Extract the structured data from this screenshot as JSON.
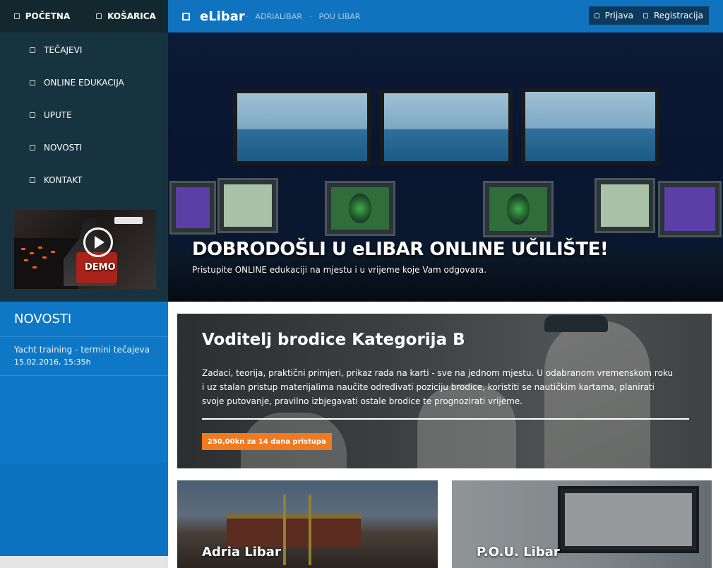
{
  "sidebar": {
    "top": [
      {
        "label": "POČETNA",
        "icon": "square-icon"
      },
      {
        "label": "KOŠARICA",
        "icon": "square-icon"
      }
    ],
    "menu": [
      {
        "label": "TEČAJEVI"
      },
      {
        "label": "ONLINE EDUKACIJA"
      },
      {
        "label": "UPUTE"
      },
      {
        "label": "NOVOSTI"
      },
      {
        "label": "KONTAKT"
      }
    ],
    "demo_label": "DEMO"
  },
  "news": {
    "heading": "NOVOSTI",
    "items": [
      {
        "title": "Yacht training - termini tečajeva",
        "date": "15.02.2016, 15:35h"
      }
    ]
  },
  "header": {
    "brand": "eLibar",
    "crumbs": [
      "ADRIALIBAR",
      "POU LIBAR"
    ],
    "login": "Prijava",
    "register": "Registracija"
  },
  "hero": {
    "title": "DOBRODOŠLI U eLIBAR ONLINE UČILIŠTE!",
    "subtitle": "Pristupite ONLINE edukaciji na mjestu i u vrijeme koje Vam odgovara."
  },
  "course": {
    "title": "Voditelj brodice Kategorija B",
    "description": "Zadaci, teorija, praktični primjeri, prikaz rada na karti - sve na jednom mjestu. U odabranom vremenskom roku i uz stalan pristup materijalima naučite određivati poziciju brodice, koristiti se nautičkim kartama, planirati svoje putovanje, pravilno izbjegavati ostale brodice te prognozirati vrijeme.",
    "price": "250,00kn za 14 dana pristupa"
  },
  "cards": [
    {
      "title": "Adria Libar"
    },
    {
      "title": "P.O.U. Libar"
    }
  ],
  "colors": {
    "sidebar": "#183340",
    "header": "#0f73c0",
    "news": "#0e78c6",
    "price_badge": "#f07a20"
  }
}
